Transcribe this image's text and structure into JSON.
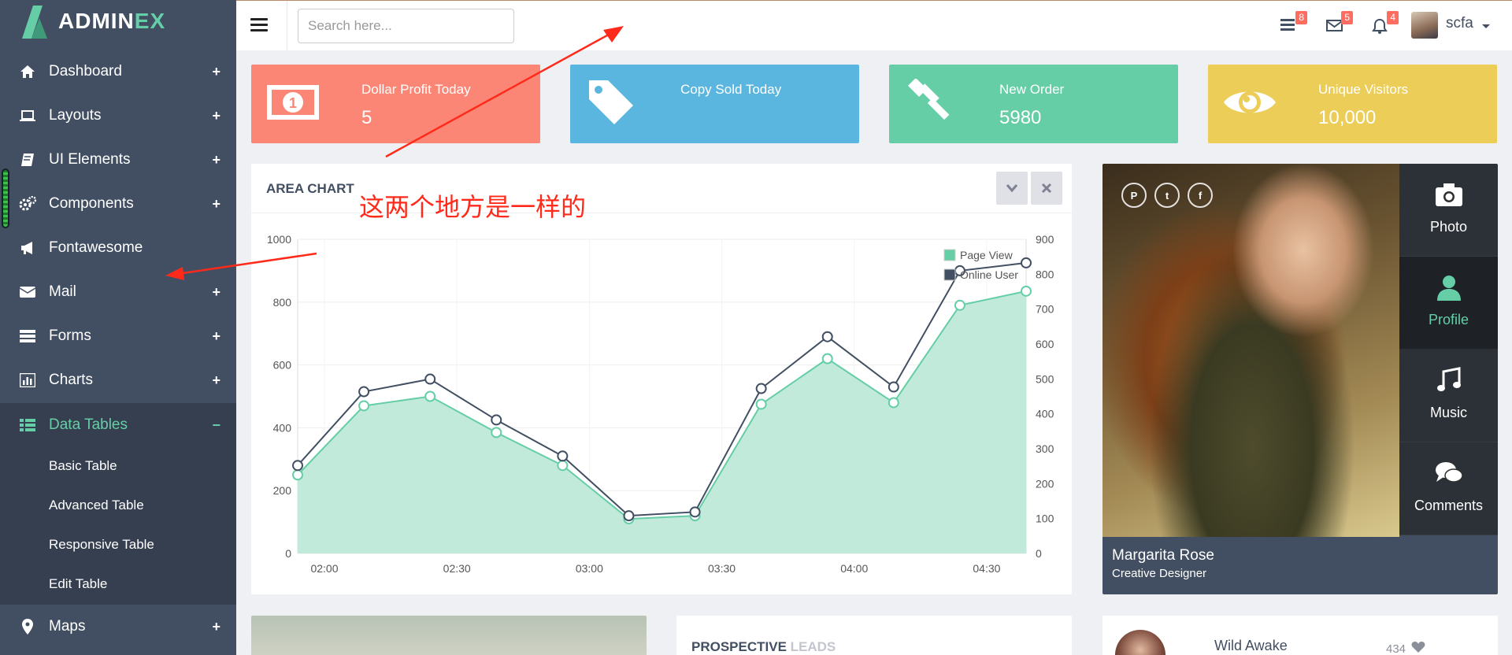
{
  "app": {
    "logo_text_main": "ADMIN",
    "logo_text_accent": "EX"
  },
  "sidebar": {
    "items": [
      {
        "label": "Dashboard",
        "icon": "home-icon",
        "expand": "+"
      },
      {
        "label": "Layouts",
        "icon": "laptop-icon",
        "expand": "+"
      },
      {
        "label": "UI Elements",
        "icon": "book-icon",
        "expand": "+"
      },
      {
        "label": "Components",
        "icon": "cogs-icon",
        "expand": "+"
      },
      {
        "label": "Fontawesome",
        "icon": "bullhorn-icon",
        "expand": ""
      },
      {
        "label": "Mail",
        "icon": "envelope-icon",
        "expand": "+"
      },
      {
        "label": "Forms",
        "icon": "tasks-icon",
        "expand": "+"
      },
      {
        "label": "Charts",
        "icon": "bar-chart-icon",
        "expand": "+"
      },
      {
        "label": "Data Tables",
        "icon": "table-icon",
        "expand": "−",
        "active": true
      },
      {
        "label": "Maps",
        "icon": "map-marker-icon",
        "expand": "+"
      }
    ],
    "submenu": [
      "Basic Table",
      "Advanced Table",
      "Responsive Table",
      "Edit Table"
    ]
  },
  "header": {
    "search_placeholder": "Search here...",
    "badges": {
      "tasks": "8",
      "mail": "5",
      "notifications": "4"
    },
    "username": "scfa"
  },
  "stats": [
    {
      "title": "Dollar Profit Today",
      "value": "5",
      "color": "#fc8675",
      "icon": "money-icon"
    },
    {
      "title": "Copy Sold Today",
      "value": "",
      "color": "#5ab6df",
      "icon": "tag-icon"
    },
    {
      "title": "New Order",
      "value": "5980",
      "color": "#65cea7",
      "icon": "gavel-icon"
    },
    {
      "title": "Unique Visitors",
      "value": "10,000",
      "color": "#ebcd58",
      "icon": "eye-icon"
    }
  ],
  "area_chart": {
    "title": "AREA CHART"
  },
  "chart_data": {
    "type": "line",
    "x": [
      "02:00",
      "02:30",
      "03:00",
      "03:30",
      "04:00",
      "04:30"
    ],
    "x_points": 12,
    "ylim_left": [
      0,
      1000
    ],
    "yticks_left": [
      0,
      200,
      400,
      600,
      800,
      1000
    ],
    "ylim_right": [
      0,
      900
    ],
    "yticks_right": [
      0,
      100,
      200,
      300,
      400,
      500,
      600,
      700,
      800,
      900
    ],
    "legend_position": "top-right",
    "series": [
      {
        "name": "Page View",
        "color": "#65cea7",
        "fill": "#c2eadb",
        "values": [
          250,
          470,
          500,
          385,
          280,
          110,
          120,
          475,
          620,
          480,
          790,
          835
        ]
      },
      {
        "name": "Online User",
        "color": "#424f63",
        "values": [
          280,
          515,
          555,
          425,
          310,
          120,
          132,
          525,
          690,
          530,
          900,
          925
        ]
      }
    ]
  },
  "profile": {
    "name": "Margarita Rose",
    "role": "Creative Designer",
    "tabs": [
      {
        "label": "Photo",
        "icon": "camera-icon"
      },
      {
        "label": "Profile",
        "icon": "user-icon",
        "active": true
      },
      {
        "label": "Music",
        "icon": "music-icon"
      },
      {
        "label": "Comments",
        "icon": "comments-icon"
      }
    ],
    "social": [
      "pinterest-icon",
      "twitter-icon",
      "facebook-icon"
    ]
  },
  "leads": {
    "title_main": "PROSPECTIVE",
    "title_muted": "LEADS"
  },
  "wild_awake": {
    "name": "Wild Awake",
    "count": "434"
  },
  "annotation": {
    "text": "这两个地方是一样的",
    "color": "#ff2a1a"
  }
}
